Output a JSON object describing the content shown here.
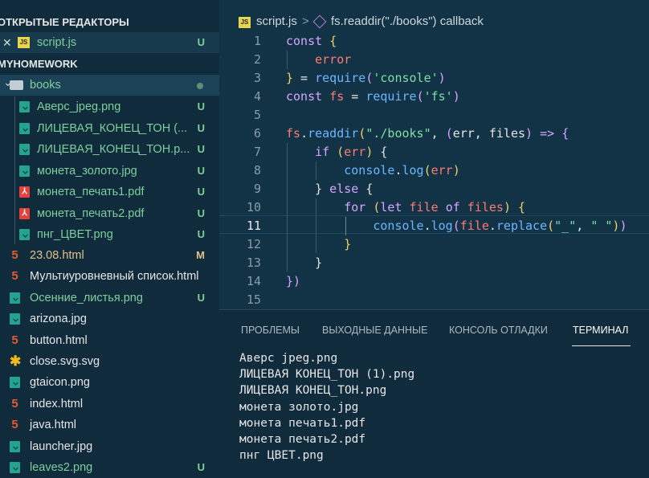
{
  "explorer": {
    "open_editors_header": "ОТКРЫТЫЕ РЕДАКТОРЫ",
    "open_editor": {
      "close_glyph": "✕",
      "badge": "JS",
      "name": "script.js",
      "status": "U"
    },
    "workspace_header": "MYHOMEWORK",
    "folder": {
      "chevron": "⌄",
      "name": "books"
    },
    "books": [
      {
        "name": "Аверс_jpeg.png",
        "icon": "image-icon",
        "status": "U"
      },
      {
        "name": "ЛИЦЕВАЯ_КОНЕЦ_ТОН (...",
        "icon": "image-icon",
        "status": "U"
      },
      {
        "name": "ЛИЦЕВАЯ_КОНЕЦ_ТОН.p...",
        "icon": "image-icon",
        "status": "U"
      },
      {
        "name": "монета_золото.jpg",
        "icon": "image-icon",
        "status": "U"
      },
      {
        "name": "монета_печать1.pdf",
        "icon": "pdf-icon",
        "status": "U"
      },
      {
        "name": "монета_печать2.pdf",
        "icon": "pdf-icon",
        "status": "U"
      },
      {
        "name": "пнг_ЦВЕТ.png",
        "icon": "image-icon",
        "status": "U"
      }
    ],
    "files": [
      {
        "name": "23.08.html",
        "icon": "html-icon",
        "status": "M"
      },
      {
        "name": "Мультиуровневный список.html",
        "icon": "html-icon",
        "status": ""
      },
      {
        "name": "Осенние_листья.png",
        "icon": "image-icon",
        "status": "U"
      },
      {
        "name": "arizona.jpg",
        "icon": "image-icon",
        "status": ""
      },
      {
        "name": "button.html",
        "icon": "html-icon",
        "status": ""
      },
      {
        "name": "close.svg.svg",
        "icon": "svg-icon",
        "status": ""
      },
      {
        "name": "gtaicon.png",
        "icon": "image-icon",
        "status": ""
      },
      {
        "name": "index.html",
        "icon": "html-icon",
        "status": ""
      },
      {
        "name": "java.html",
        "icon": "html-icon",
        "status": ""
      },
      {
        "name": "launcher.jpg",
        "icon": "image-icon",
        "status": ""
      },
      {
        "name": "leaves2.png",
        "icon": "image-icon",
        "status": "U"
      }
    ]
  },
  "editor": {
    "breadcrumb": {
      "file": "script.js",
      "separator": ">",
      "symbol": "fs.readdir(\"./books\") callback"
    },
    "line_numbers": [
      "1",
      "2",
      "3",
      "4",
      "5",
      "6",
      "7",
      "8",
      "9",
      "10",
      "11",
      "12",
      "13",
      "14",
      "15"
    ]
  },
  "panel": {
    "tabs": [
      {
        "label": "ПРОБЛЕМЫ"
      },
      {
        "label": "ВЫХОДНЫЕ ДАННЫЕ"
      },
      {
        "label": "КОНСОЛЬ ОТЛАДКИ"
      },
      {
        "label": "ТЕРМИНАЛ",
        "active": true
      }
    ],
    "terminal_output": [
      "Аверс jpeg.png",
      "ЛИЦЕВАЯ КОНЕЦ_ТОН (1).png",
      "ЛИЦЕВАЯ КОНЕЦ_ТОН.png",
      "монета золото.jpg",
      "монета печать1.pdf",
      "монета печать2.pdf",
      "пнг ЦВЕТ.png"
    ]
  },
  "colors": {
    "accent_untracked": "#7fcf9c",
    "accent_modified": "#e2c08d",
    "editor_bg": "#123246",
    "sidebar_bg": "#0f2b3c"
  }
}
